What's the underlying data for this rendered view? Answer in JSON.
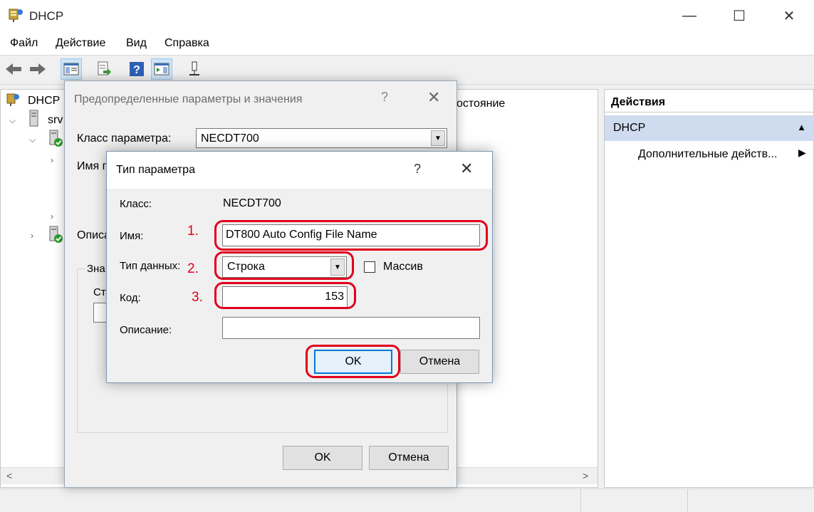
{
  "window": {
    "title": "DHCP",
    "app_icon": "dhcp-server-icon"
  },
  "caption_buttons": {
    "minimize": "—",
    "maximize": "☐",
    "close": "✕"
  },
  "menu": [
    "Файл",
    "Действие",
    "Вид",
    "Справка"
  ],
  "toolbar": [
    "back-icon",
    "forward-icon",
    "show-hide-tree-icon",
    "export-list-icon",
    "help-icon",
    "show-action-pane-icon",
    "plugin-icon"
  ],
  "tree": {
    "root": "DHCP",
    "server": "srv",
    "scroll_left": "<"
  },
  "center": {
    "column_fragment": "остояние",
    "scroll_right": ">"
  },
  "actions": {
    "header": "Действия",
    "selected": "DHCP",
    "selected_arrow": "▲",
    "more": "Дополнительные действ...",
    "more_arrow": "▶"
  },
  "dialog_predefined": {
    "title": "Предопределенные параметры и значения",
    "help": "?",
    "close": "✕",
    "class_label": "Класс параметра:",
    "class_value": "NECDT700",
    "name_label_fragment": "Имя п",
    "desc_label_fragment": "Описа",
    "value_group_fragment": "Зна",
    "string_fragment": "Ст",
    "ok": "OK",
    "cancel": "Отмена"
  },
  "dialog_option_type": {
    "title": "Тип параметра",
    "help": "?",
    "close": "✕",
    "class_label": "Класс:",
    "class_value": "NECDT700",
    "name_label": "Имя:",
    "name_value": "DT800 Auto Config File Name",
    "type_label": "Тип данных:",
    "type_value": "Строка",
    "array_label": "Массив",
    "array_checked": false,
    "code_label": "Код:",
    "code_value": "153",
    "desc_label": "Описание:",
    "desc_value": "",
    "ok": "OK",
    "cancel": "Отмена"
  },
  "annotations": {
    "step1": "1.",
    "step2": "2.",
    "step3": "3.",
    "color": "#e0001b"
  }
}
